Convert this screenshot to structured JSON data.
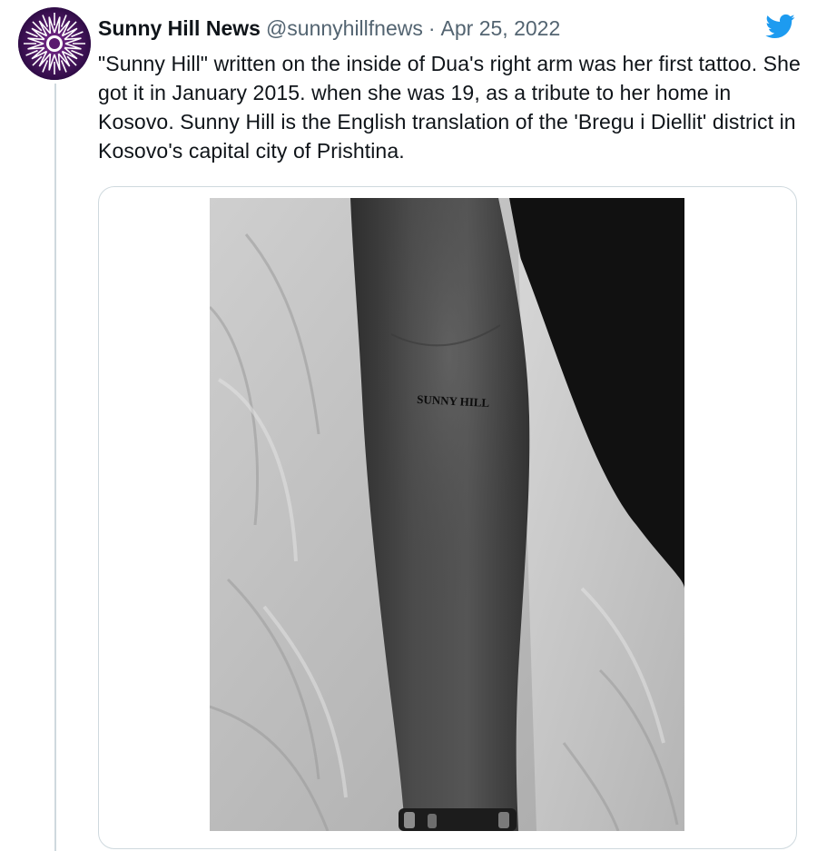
{
  "tweet": {
    "author": {
      "display_name": "Sunny Hill News",
      "handle": "@sunnyhillfnews",
      "separator": "·",
      "date": "Apr 25, 2022"
    },
    "text": "\"Sunny Hill\" written on the inside of Dua's right arm was her first tattoo. She got it in January 2015. when she was 19, as a tribute to her home in Kosovo. Sunny Hill is the English translation of the 'Bregu i Diellit' district in Kosovo's capital city of Prishtina.",
    "media": {
      "tattoo_text": "SUNNY HILL"
    },
    "icons": {
      "platform": "twitter-bird-icon",
      "avatar": "sun-logo-icon"
    }
  },
  "colors": {
    "twitter_blue": "#1d9bf0",
    "secondary_text": "#536471",
    "border": "#cfd9de",
    "avatar_purple": "#5a1a6e"
  }
}
